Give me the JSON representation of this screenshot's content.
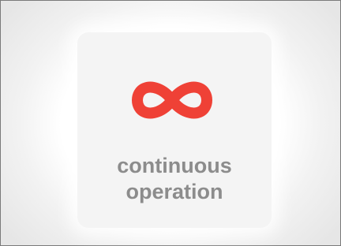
{
  "feature": {
    "icon": "infinity-icon",
    "icon_color": "#ef4136",
    "label_line1": "continuous",
    "label_line2": "operation",
    "label_color": "#8c8c8c"
  }
}
